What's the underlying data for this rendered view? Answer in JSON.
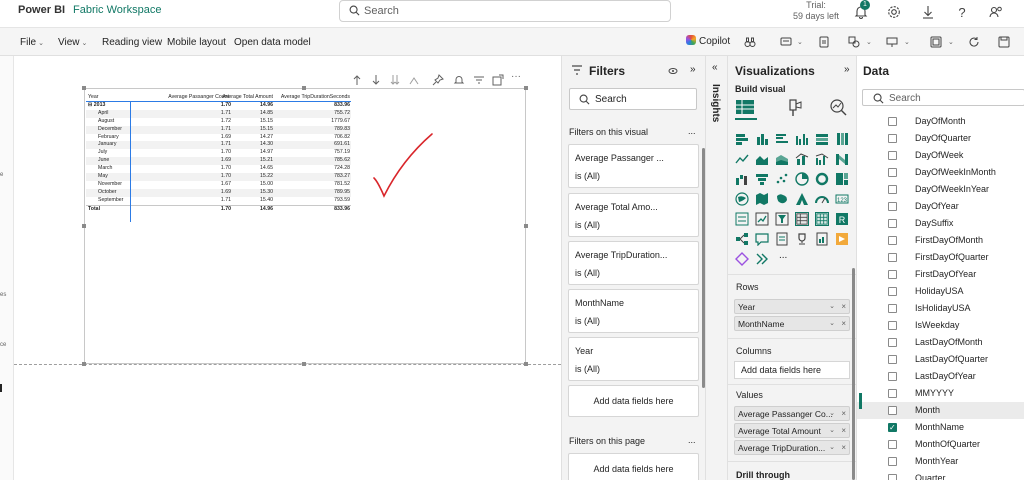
{
  "topbar": {
    "brand": "Power BI",
    "workspace": "Fabric Workspace",
    "search_placeholder": "Search",
    "trial_line1": "Trial:",
    "trial_line2": "59 days left",
    "notification_count": "1",
    "icons": [
      "bell-icon",
      "gear-icon",
      "download-icon",
      "help-icon",
      "share-people-icon"
    ]
  },
  "ribbon": {
    "file": "File",
    "view": "View",
    "reading_view": "Reading view",
    "mobile_layout": "Mobile layout",
    "open_data_model": "Open data model",
    "copilot": "Copilot"
  },
  "leftedge": {
    "t1": "e",
    "t2": "es",
    "t3": "ce"
  },
  "matrix": {
    "headers": [
      "Year",
      "Average Passanger Count",
      "Average Total Amount",
      "Average TripDurationSeconds"
    ],
    "year_row": {
      "label": "2013",
      "c1": "1.70",
      "c2": "14.96",
      "c3": "833.96"
    },
    "rows": [
      {
        "label": "April",
        "c1": "1.71",
        "c2": "14.85",
        "c3": "755.72"
      },
      {
        "label": "August",
        "c1": "1.72",
        "c2": "15.15",
        "c3": "1779.67"
      },
      {
        "label": "December",
        "c1": "1.71",
        "c2": "15.15",
        "c3": "789.83"
      },
      {
        "label": "February",
        "c1": "1.69",
        "c2": "14.27",
        "c3": "706.82"
      },
      {
        "label": "January",
        "c1": "1.71",
        "c2": "14.30",
        "c3": "691.61"
      },
      {
        "label": "July",
        "c1": "1.70",
        "c2": "14.97",
        "c3": "757.19"
      },
      {
        "label": "June",
        "c1": "1.69",
        "c2": "15.21",
        "c3": "785.62"
      },
      {
        "label": "March",
        "c1": "1.70",
        "c2": "14.65",
        "c3": "724.28"
      },
      {
        "label": "May",
        "c1": "1.70",
        "c2": "15.22",
        "c3": "783.27"
      },
      {
        "label": "November",
        "c1": "1.67",
        "c2": "15.00",
        "c3": "781.52"
      },
      {
        "label": "October",
        "c1": "1.69",
        "c2": "15.30",
        "c3": "789.95"
      },
      {
        "label": "September",
        "c1": "1.71",
        "c2": "15.40",
        "c3": "793.59"
      }
    ],
    "total_row": {
      "label": "Total",
      "c1": "1.70",
      "c2": "14.96",
      "c3": "833.96"
    }
  },
  "filters": {
    "title": "Filters",
    "search_placeholder": "Search",
    "on_visual": "Filters on this visual",
    "cards": [
      {
        "name": "Average Passanger ...",
        "value": "is (All)"
      },
      {
        "name": "Average Total Amo...",
        "value": "is (All)"
      },
      {
        "name": "Average TripDuration...",
        "value": "is (All)"
      },
      {
        "name": "MonthName",
        "value": "is (All)"
      },
      {
        "name": "Year",
        "value": "is (All)"
      }
    ],
    "add_fields": "Add data fields here",
    "on_page": "Filters on this page",
    "add_fields_page": "Add data fields here",
    "more": "..."
  },
  "insights": {
    "label": "Insights"
  },
  "visualizations": {
    "title": "Visualizations",
    "build_visual": "Build visual",
    "rows_label": "Rows",
    "rows": [
      "Year",
      "MonthName"
    ],
    "columns_label": "Columns",
    "columns_add": "Add data fields here",
    "values_label": "Values",
    "values": [
      "Average Passanger Co...",
      "Average Total Amount",
      "Average TripDuration..."
    ],
    "drill_through": "Drill through",
    "more_visuals": "..."
  },
  "data": {
    "title": "Data",
    "search_placeholder": "Search",
    "fields": [
      {
        "label": "DayOfMonth",
        "checked": false
      },
      {
        "label": "DayOfQuarter",
        "checked": false
      },
      {
        "label": "DayOfWeek",
        "checked": false
      },
      {
        "label": "DayOfWeekInMonth",
        "checked": false
      },
      {
        "label": "DayOfWeekInYear",
        "checked": false
      },
      {
        "label": "DayOfYear",
        "checked": false
      },
      {
        "label": "DaySuffix",
        "checked": false
      },
      {
        "label": "FirstDayOfMonth",
        "checked": false
      },
      {
        "label": "FirstDayOfQuarter",
        "checked": false
      },
      {
        "label": "FirstDayOfYear",
        "checked": false
      },
      {
        "label": "HolidayUSA",
        "checked": false
      },
      {
        "label": "IsHolidayUSA",
        "checked": false
      },
      {
        "label": "IsWeekday",
        "checked": false
      },
      {
        "label": "LastDayOfMonth",
        "checked": false
      },
      {
        "label": "LastDayOfQuarter",
        "checked": false
      },
      {
        "label": "LastDayOfYear",
        "checked": false
      },
      {
        "label": "MMYYYY",
        "checked": false
      },
      {
        "label": "Month",
        "checked": false
      },
      {
        "label": "MonthName",
        "checked": true
      },
      {
        "label": "MonthOfQuarter",
        "checked": false
      },
      {
        "label": "MonthYear",
        "checked": false
      },
      {
        "label": "Quarter",
        "checked": false
      }
    ],
    "selected_field": "Month"
  },
  "colors": {
    "accent": "#117865",
    "check_mark": "#d9262b",
    "matrix_line": "#2c7be5"
  }
}
